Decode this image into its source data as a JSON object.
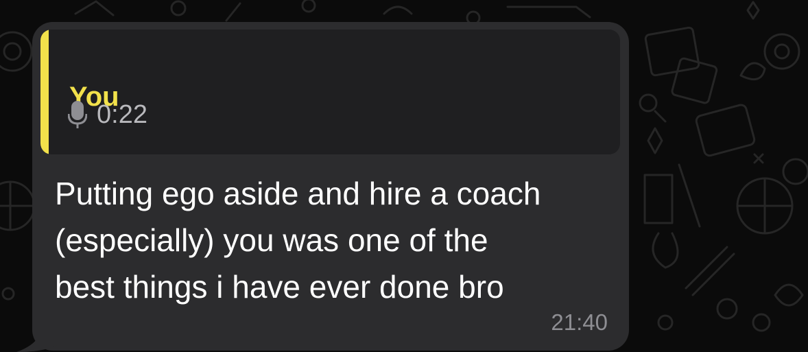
{
  "reply_quote": {
    "author": "You",
    "icon": "microphone-icon",
    "duration": "0:22",
    "accent_color": "#f2e14b"
  },
  "message": {
    "text": "Putting ego aside and hire a coach\n(especially) you was one of the\nbest things i have ever done bro",
    "time": "21:40",
    "bubble_color": "#2c2c2e"
  }
}
